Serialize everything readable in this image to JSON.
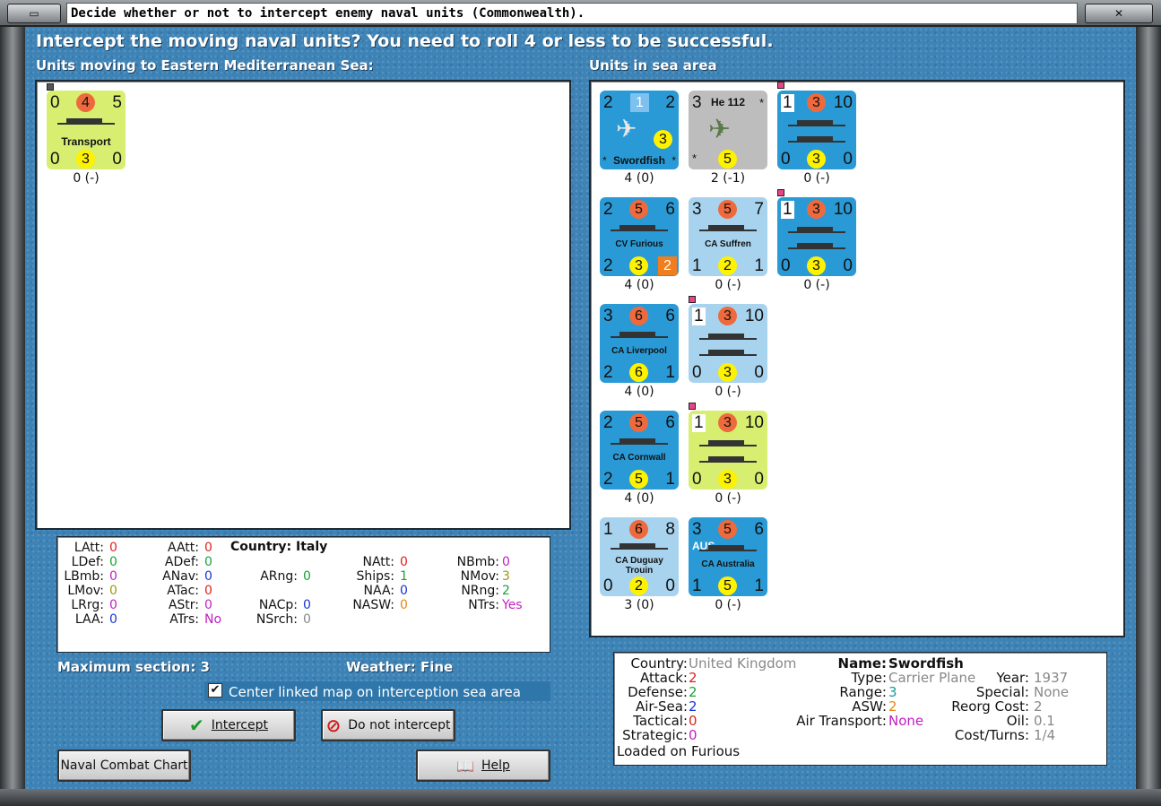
{
  "window": {
    "title": "Decide whether or not to intercept enemy naval units (Commonwealth).",
    "heading": "Intercept the moving naval units?  You need to roll 4 or less to be successful."
  },
  "moving": {
    "label": "Units moving to Eastern Mediterranean Sea:",
    "transport": {
      "tl": "0",
      "tc": "4",
      "tr": "5",
      "name": "Transport",
      "bl": "0",
      "bc": "3",
      "br": "0",
      "caption": "0 (-)"
    }
  },
  "sea": {
    "label": "Units in sea area",
    "swordfish": {
      "tl": "2",
      "tc": "1",
      "tr": "2",
      "mid": "3",
      "name": "Swordfish",
      "star": "*",
      "caption": "4 (0)"
    },
    "he112": {
      "tl": "3",
      "name": "He 112",
      "star": "*",
      "bc": "5",
      "caption": "2 (-1)"
    },
    "transport_a": {
      "tl": "1",
      "tc": "3",
      "tr": "10",
      "bl": "0",
      "bc": "3",
      "br": "0",
      "caption": "0 (-)"
    },
    "furious": {
      "tl": "2",
      "tc": "5",
      "tr": "6",
      "name": "CV Furious",
      "bl": "2",
      "bc": "3",
      "br": "2",
      "caption": "4 (0)"
    },
    "suffren": {
      "tl": "3",
      "tc": "5",
      "tr": "7",
      "name": "CA Suffren",
      "bl": "1",
      "bc": "2",
      "br": "1",
      "caption": "0 (-)"
    },
    "transport_b": {
      "tl": "1",
      "tc": "3",
      "tr": "10",
      "bl": "0",
      "bc": "3",
      "br": "0",
      "caption": "0 (-)"
    },
    "liverpool": {
      "tl": "3",
      "tc": "6",
      "tr": "6",
      "name": "CA Liverpool",
      "bl": "2",
      "bc": "6",
      "br": "1",
      "caption": "4 (0)"
    },
    "transport_c": {
      "tl": "1",
      "tc": "3",
      "tr": "10",
      "bl": "0",
      "bc": "3",
      "br": "0",
      "caption": "0 (-)"
    },
    "cornwall": {
      "tl": "2",
      "tc": "5",
      "tr": "6",
      "name": "CA Cornwall",
      "bl": "2",
      "bc": "5",
      "br": "1",
      "caption": "4 (0)"
    },
    "transport_d": {
      "tl": "1",
      "tc": "3",
      "tr": "10",
      "bl": "0",
      "bc": "3",
      "br": "0",
      "caption": "0 (-)"
    },
    "duguay": {
      "tl": "1",
      "tc": "6",
      "tr": "8",
      "name1": "CA Duguay",
      "name2": "Trouin",
      "bl": "0",
      "bc": "2",
      "br": "0",
      "caption": "3 (0)"
    },
    "australia": {
      "tl": "3",
      "tc": "5",
      "tr": "6",
      "flag": "AUS",
      "name": "CA Australia",
      "bl": "1",
      "bc": "5",
      "br": "1",
      "caption": "0 (-)"
    }
  },
  "stats": {
    "country_label": "Country: Italy",
    "LAtt": {
      "k": "LAtt:",
      "v": "0"
    },
    "LDef": {
      "k": "LDef:",
      "v": "0"
    },
    "LBmb": {
      "k": "LBmb:",
      "v": "0"
    },
    "LMov": {
      "k": "LMov:",
      "v": "0"
    },
    "LRrg": {
      "k": "LRrg:",
      "v": "0"
    },
    "LAA": {
      "k": "LAA:",
      "v": "0"
    },
    "AAtt": {
      "k": "AAtt:",
      "v": "0"
    },
    "ADef": {
      "k": "ADef:",
      "v": "0"
    },
    "ANav": {
      "k": "ANav:",
      "v": "0"
    },
    "ATac": {
      "k": "ATac:",
      "v": "0"
    },
    "AStr": {
      "k": "AStr:",
      "v": "0"
    },
    "ATrs": {
      "k": "ATrs:",
      "v": "No"
    },
    "ARng": {
      "k": "ARng:",
      "v": "0"
    },
    "NACp": {
      "k": "NACp:",
      "v": "0"
    },
    "NSrch": {
      "k": "NSrch:",
      "v": "0"
    },
    "NAtt": {
      "k": "NAtt:",
      "v": "0"
    },
    "Ships": {
      "k": "Ships:",
      "v": "1"
    },
    "NAA": {
      "k": "NAA:",
      "v": "0"
    },
    "NASW": {
      "k": "NASW:",
      "v": "0"
    },
    "NBmb": {
      "k": "NBmb:",
      "v": "0"
    },
    "NMov": {
      "k": "NMov:",
      "v": "3"
    },
    "NRng": {
      "k": "NRng:",
      "v": "2"
    },
    "NTrs": {
      "k": "NTrs:",
      "v": "Yes"
    }
  },
  "footer": {
    "max_section": "Maximum section: 3",
    "weather_label": "Weather:",
    "weather_value": "Fine",
    "center_check": "Center linked map on interception sea area",
    "intercept": "Intercept",
    "no_intercept": "Do not intercept",
    "naval_chart": "Naval Combat Chart",
    "help": "Help"
  },
  "info": {
    "country_k": "Country:",
    "country_v": "United Kingdom",
    "attack_k": "Attack:",
    "attack_v": "2",
    "defense_k": "Defense:",
    "defense_v": "2",
    "airsea_k": "Air-Sea:",
    "airsea_v": "2",
    "tactical_k": "Tactical:",
    "tactical_v": "0",
    "strategic_k": "Strategic:",
    "strategic_v": "0",
    "loaded": "Loaded on Furious",
    "name_k": "Name:",
    "name_v": "Swordfish",
    "type_k": "Type:",
    "type_v": "Carrier Plane",
    "range_k": "Range:",
    "range_v": "3",
    "asw_k": "ASW:",
    "asw_v": "2",
    "airtrans_k": "Air Transport:",
    "airtrans_v": "None",
    "year_k": "Year:",
    "year_v": "1937",
    "special_k": "Special:",
    "special_v": "None",
    "reorg_k": "Reorg Cost:",
    "reorg_v": "2",
    "oil_k": "Oil:",
    "oil_v": "0.1",
    "cost_k": "Cost/Turns:",
    "cost_v": "1/4"
  },
  "colors": {
    "sea_blue": "#3d83b6",
    "counter_blue": "#2a9ad6",
    "counter_light": "#a8d3ee",
    "counter_green": "#d8ee70",
    "counter_grey": "#bdbdbd"
  }
}
